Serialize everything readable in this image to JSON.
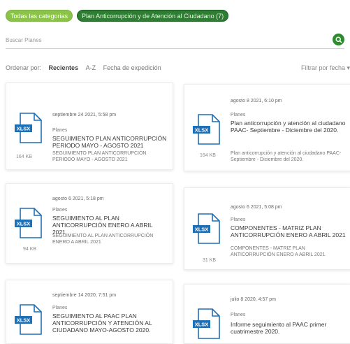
{
  "tags": [
    {
      "label": "Todas las categorias"
    },
    {
      "label": "Plan Anticorrupción y de Atención al Ciudadano (7)"
    }
  ],
  "search": {
    "placeholder": "Buscar Planes"
  },
  "sort": {
    "label": "Ordenar por:",
    "options": [
      "Recientes",
      "A-Z",
      "Fecha de expedición"
    ],
    "filter": "Filtrar por fecha ▾"
  },
  "cards": [
    {
      "date": "septiembre 24 2021, 5:58 pm",
      "category": "Planes",
      "title": "SEGUIMIENTO PLAN ANTICORRUPCIÓN PERIODO MAYO - AGOSTO 2021",
      "description": "SEGUIMIENTO PLAN ANTICORRUPCIÓN PERIODO MAYO - AGOSTO 2021",
      "ext": "XLSX",
      "size": "164 KB"
    },
    {
      "date": "agosto 8 2021, 6:10 pm",
      "category": "Planes",
      "title": "Plan anticorrupción y atención al ciudadano PAAC- Septiembre - Diciembre del 2020.",
      "description": "Plan anticorrupción y atención al ciudadano PAAC- Septiembre - Diciembre del 2020.",
      "ext": "XLSX",
      "size": "164 KB"
    },
    {
      "date": "agosto 6 2021, 5:18 pm",
      "category": "Planes",
      "title": "SEGUIMIENTO AL PLAN ANTICORRUPCIÓN ENERO A ABRIL 2021",
      "description": "SEGUIMIENTO AL PLAN ANTICORRUPCIÓN ENERO A ABRIL 2021",
      "ext": "XLSX",
      "size": "94 KB"
    },
    {
      "date": "agosto 6 2021, 5:08 pm",
      "category": "Planes",
      "title": "COMPONENTES - MATRIZ PLAN ANTICORRUPCIÓN ENERO A ABRIL 2021",
      "description": "COMPONENTES - MATRIZ PLAN ANTICORRUPCIÓN ENERO A ABRIL 2021",
      "ext": "XLSX",
      "size": "31 KB"
    },
    {
      "date": "septiembre 14 2020, 7:51 pm",
      "category": "Planes",
      "title": "SEGUIMIENTO AL PAAC PLAN ANTICORRUPCIÓN Y ATENCIÓN AL CIUDADANO MAYO-AGOSTO 2020.",
      "description": "",
      "ext": "XLSX",
      "size": ""
    },
    {
      "date": "julio 8 2020, 4:57 pm",
      "category": "Planes",
      "title": "Informe seguimiento al PAAC primer cuatrimestre 2020.",
      "description": "",
      "ext": "XLSX",
      "size": ""
    }
  ],
  "colors": {
    "accent": "#2e8b2e",
    "xlsx_badge": "#1f6fb5",
    "tag_light": "#8bc34a",
    "tag_dark": "#2e7d32"
  },
  "icons": {
    "search": "search-icon",
    "file": "xlsx-file-icon"
  }
}
